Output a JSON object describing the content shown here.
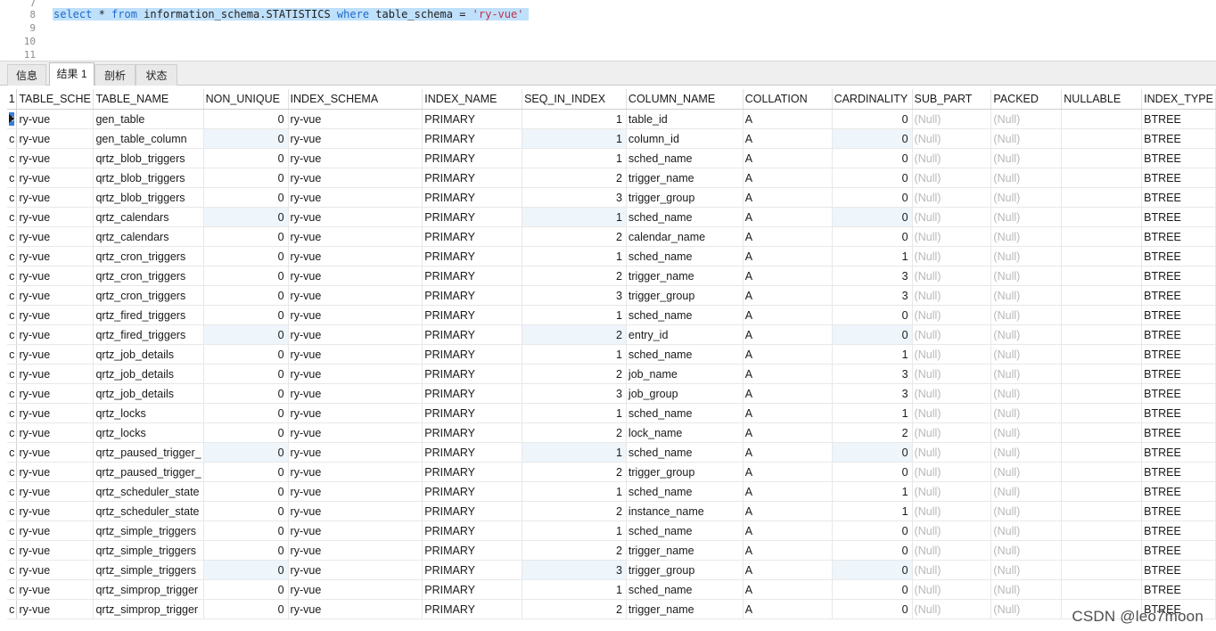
{
  "editor": {
    "lines": [
      {
        "num": "7",
        "text": ""
      },
      {
        "num": "8",
        "text": "select * from information_schema.STATISTICS where table_schema = 'ry-vue'"
      },
      {
        "num": "9",
        "text": ""
      },
      {
        "num": "10",
        "text": ""
      },
      {
        "num": "11",
        "text": ""
      }
    ],
    "query_parts": {
      "select": "select",
      "star": " * ",
      "from": "from",
      "table": " information_schema.STATISTICS ",
      "where": "where",
      "cond": " table_schema = ",
      "value": "'ry-vue'"
    }
  },
  "tabs": [
    {
      "label": "信息",
      "active": false
    },
    {
      "label": "结果 1",
      "active": true
    },
    {
      "label": "剖析",
      "active": false
    },
    {
      "label": "状态",
      "active": false
    }
  ],
  "grid": {
    "row_header_label": "1",
    "columns": [
      "TABLE_SCHE",
      "TABLE_NAME",
      "NON_UNIQUE",
      "INDEX_SCHEMA",
      "INDEX_NAME",
      "SEQ_IN_INDEX",
      "COLUMN_NAME",
      "COLLATION",
      "CARDINALITY",
      "SUB_PART",
      "PACKED",
      "NULLABLE",
      "INDEX_TYPE"
    ],
    "catalog_marker": "c",
    "null_text": "(Null)",
    "rows": [
      [
        "ry-vue",
        "gen_table",
        "0",
        "ry-vue",
        "PRIMARY",
        "1",
        "table_id",
        "A",
        "0",
        "(Null)",
        "(Null)",
        "",
        "BTREE"
      ],
      [
        "ry-vue",
        "gen_table_column",
        "0",
        "ry-vue",
        "PRIMARY",
        "1",
        "column_id",
        "A",
        "0",
        "(Null)",
        "(Null)",
        "",
        "BTREE"
      ],
      [
        "ry-vue",
        "qrtz_blob_triggers",
        "0",
        "ry-vue",
        "PRIMARY",
        "1",
        "sched_name",
        "A",
        "0",
        "(Null)",
        "(Null)",
        "",
        "BTREE"
      ],
      [
        "ry-vue",
        "qrtz_blob_triggers",
        "0",
        "ry-vue",
        "PRIMARY",
        "2",
        "trigger_name",
        "A",
        "0",
        "(Null)",
        "(Null)",
        "",
        "BTREE"
      ],
      [
        "ry-vue",
        "qrtz_blob_triggers",
        "0",
        "ry-vue",
        "PRIMARY",
        "3",
        "trigger_group",
        "A",
        "0",
        "(Null)",
        "(Null)",
        "",
        "BTREE"
      ],
      [
        "ry-vue",
        "qrtz_calendars",
        "0",
        "ry-vue",
        "PRIMARY",
        "1",
        "sched_name",
        "A",
        "0",
        "(Null)",
        "(Null)",
        "",
        "BTREE"
      ],
      [
        "ry-vue",
        "qrtz_calendars",
        "0",
        "ry-vue",
        "PRIMARY",
        "2",
        "calendar_name",
        "A",
        "0",
        "(Null)",
        "(Null)",
        "",
        "BTREE"
      ],
      [
        "ry-vue",
        "qrtz_cron_triggers",
        "0",
        "ry-vue",
        "PRIMARY",
        "1",
        "sched_name",
        "A",
        "1",
        "(Null)",
        "(Null)",
        "",
        "BTREE"
      ],
      [
        "ry-vue",
        "qrtz_cron_triggers",
        "0",
        "ry-vue",
        "PRIMARY",
        "2",
        "trigger_name",
        "A",
        "3",
        "(Null)",
        "(Null)",
        "",
        "BTREE"
      ],
      [
        "ry-vue",
        "qrtz_cron_triggers",
        "0",
        "ry-vue",
        "PRIMARY",
        "3",
        "trigger_group",
        "A",
        "3",
        "(Null)",
        "(Null)",
        "",
        "BTREE"
      ],
      [
        "ry-vue",
        "qrtz_fired_triggers",
        "0",
        "ry-vue",
        "PRIMARY",
        "1",
        "sched_name",
        "A",
        "0",
        "(Null)",
        "(Null)",
        "",
        "BTREE"
      ],
      [
        "ry-vue",
        "qrtz_fired_triggers",
        "0",
        "ry-vue",
        "PRIMARY",
        "2",
        "entry_id",
        "A",
        "0",
        "(Null)",
        "(Null)",
        "",
        "BTREE"
      ],
      [
        "ry-vue",
        "qrtz_job_details",
        "0",
        "ry-vue",
        "PRIMARY",
        "1",
        "sched_name",
        "A",
        "1",
        "(Null)",
        "(Null)",
        "",
        "BTREE"
      ],
      [
        "ry-vue",
        "qrtz_job_details",
        "0",
        "ry-vue",
        "PRIMARY",
        "2",
        "job_name",
        "A",
        "3",
        "(Null)",
        "(Null)",
        "",
        "BTREE"
      ],
      [
        "ry-vue",
        "qrtz_job_details",
        "0",
        "ry-vue",
        "PRIMARY",
        "3",
        "job_group",
        "A",
        "3",
        "(Null)",
        "(Null)",
        "",
        "BTREE"
      ],
      [
        "ry-vue",
        "qrtz_locks",
        "0",
        "ry-vue",
        "PRIMARY",
        "1",
        "sched_name",
        "A",
        "1",
        "(Null)",
        "(Null)",
        "",
        "BTREE"
      ],
      [
        "ry-vue",
        "qrtz_locks",
        "0",
        "ry-vue",
        "PRIMARY",
        "2",
        "lock_name",
        "A",
        "2",
        "(Null)",
        "(Null)",
        "",
        "BTREE"
      ],
      [
        "ry-vue",
        "qrtz_paused_trigger_",
        "0",
        "ry-vue",
        "PRIMARY",
        "1",
        "sched_name",
        "A",
        "0",
        "(Null)",
        "(Null)",
        "",
        "BTREE"
      ],
      [
        "ry-vue",
        "qrtz_paused_trigger_",
        "0",
        "ry-vue",
        "PRIMARY",
        "2",
        "trigger_group",
        "A",
        "0",
        "(Null)",
        "(Null)",
        "",
        "BTREE"
      ],
      [
        "ry-vue",
        "qrtz_scheduler_state",
        "0",
        "ry-vue",
        "PRIMARY",
        "1",
        "sched_name",
        "A",
        "1",
        "(Null)",
        "(Null)",
        "",
        "BTREE"
      ],
      [
        "ry-vue",
        "qrtz_scheduler_state",
        "0",
        "ry-vue",
        "PRIMARY",
        "2",
        "instance_name",
        "A",
        "1",
        "(Null)",
        "(Null)",
        "",
        "BTREE"
      ],
      [
        "ry-vue",
        "qrtz_simple_triggers",
        "0",
        "ry-vue",
        "PRIMARY",
        "1",
        "sched_name",
        "A",
        "0",
        "(Null)",
        "(Null)",
        "",
        "BTREE"
      ],
      [
        "ry-vue",
        "qrtz_simple_triggers",
        "0",
        "ry-vue",
        "PRIMARY",
        "2",
        "trigger_name",
        "A",
        "0",
        "(Null)",
        "(Null)",
        "",
        "BTREE"
      ],
      [
        "ry-vue",
        "qrtz_simple_triggers",
        "0",
        "ry-vue",
        "PRIMARY",
        "3",
        "trigger_group",
        "A",
        "0",
        "(Null)",
        "(Null)",
        "",
        "BTREE"
      ],
      [
        "ry-vue",
        "qrtz_simprop_trigger",
        "0",
        "ry-vue",
        "PRIMARY",
        "1",
        "sched_name",
        "A",
        "0",
        "(Null)",
        "(Null)",
        "",
        "BTREE"
      ],
      [
        "ry-vue",
        "qrtz_simprop_trigger",
        "0",
        "ry-vue",
        "PRIMARY",
        "2",
        "trigger_name",
        "A",
        "0",
        "(Null)",
        "(Null)",
        "",
        "BTREE"
      ]
    ]
  },
  "watermark": "CSDN @leo7moon",
  "colors": {
    "selection": "#bfe0fb",
    "keyword": "#1e6ac9",
    "string": "#c0304a",
    "null": "#b8b8b8",
    "alt_row": "#eef5fb"
  }
}
